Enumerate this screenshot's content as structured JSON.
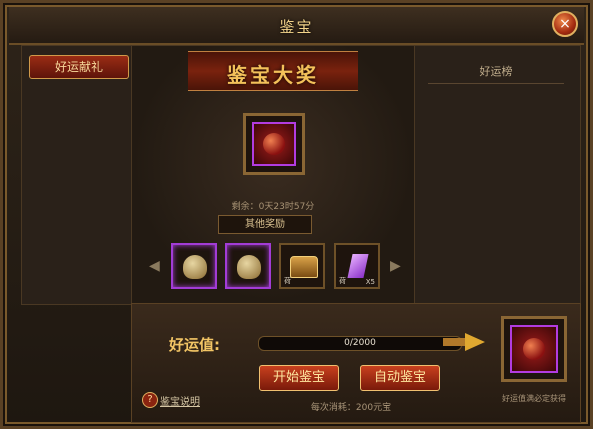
{
  "window": {
    "title": "鉴宝",
    "close_label": "×"
  },
  "left": {
    "tab_label": "好运献礼"
  },
  "right": {
    "title": "好运榜"
  },
  "center": {
    "banner": "鉴宝大奖",
    "timer": "剩余：0天23时57分",
    "other_rewards": "其他奖励",
    "items": [
      {
        "name": "nut",
        "tag": ""
      },
      {
        "name": "nut",
        "tag": ""
      },
      {
        "name": "chest",
        "tag": "荷"
      },
      {
        "name": "gem",
        "tag": "荷",
        "count": "X5"
      }
    ]
  },
  "bottom": {
    "luck_label": "好运值:",
    "progress_text": "0/2000",
    "progress_value": 0,
    "progress_max": 2000,
    "start_button": "开始鉴宝",
    "auto_button": "自动鉴宝",
    "cost": "每次消耗：200元宝",
    "help_icon": "?",
    "help_link": "鉴宝说明",
    "prize_caption": "好运值满必定获得"
  }
}
